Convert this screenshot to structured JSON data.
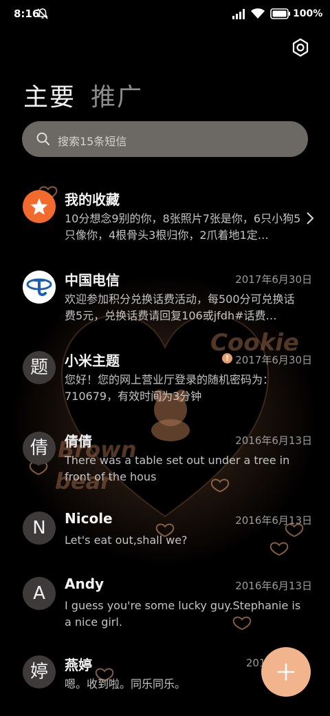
{
  "status_bar": {
    "time": "8:16",
    "battery": "100%",
    "icons": [
      "bell-muted-icon",
      "signal-icon",
      "wifi-icon",
      "battery-icon"
    ]
  },
  "header": {
    "settings_icon": "gear-icon",
    "tabs": [
      {
        "label": "主要",
        "active": true
      },
      {
        "label": "推广",
        "active": false
      }
    ]
  },
  "search": {
    "placeholder": "搜索15条短信",
    "icon": "search-icon"
  },
  "conversations": [
    {
      "avatar": "",
      "avatar_icon": "star-icon",
      "name": "我的收藏",
      "date": "",
      "snippet": "10分想念9别的你，8张照片7张是你，6只小狗5只像你，4根骨头3根归你，2爪着地1定…",
      "chevron": true
    },
    {
      "avatar": "",
      "avatar_icon": "china-telecom-logo",
      "name": "中国电信",
      "date": "2017年6月30日",
      "snippet": "欢迎参加积分兑换话费活动，每500分可兑换话费5元，兑换话费请回复106或jfdh#话费…"
    },
    {
      "avatar": "题",
      "name": "小米主题",
      "date": "2017年6月30日",
      "warning": true,
      "snippet": "您好！您的网上营业厅登录的随机密码为：710679，有效时间为3分钟"
    },
    {
      "avatar": "倩",
      "name": "倩倩",
      "date": "2016年6月13日",
      "snippet": "There was a table set out under a tree in front of the hous"
    },
    {
      "avatar": "N",
      "name": "Nicole",
      "date": "2016年6月13日",
      "snippet": "Let's eat out,shall we?"
    },
    {
      "avatar": "A",
      "name": "Andy",
      "date": "2016年6月13日",
      "snippet": "I guess you're some lucky guy.Stephanie is a nice girl."
    },
    {
      "avatar": "婷",
      "name": "燕婷",
      "date": "2013",
      "snippet": "嗯。收到啦。同乐同乐。"
    }
  ],
  "background": {
    "decor_text": [
      "Cookie",
      "Brown",
      "bear"
    ]
  },
  "fab": {
    "icon": "plus-icon"
  },
  "colors": {
    "accent": "#f2b48c",
    "star_avatar": "#f26a2e",
    "background": "#000000"
  }
}
